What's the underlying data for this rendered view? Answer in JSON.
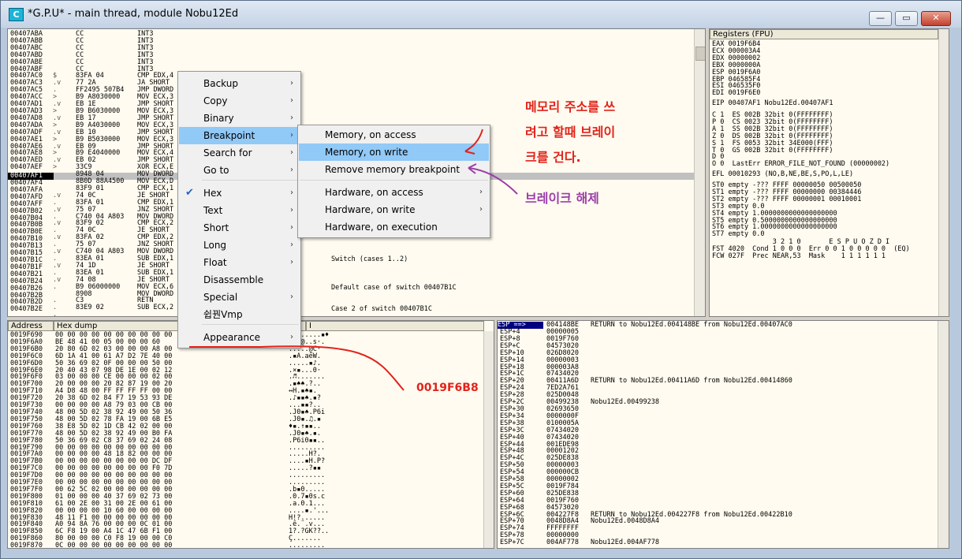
{
  "window": {
    "title": "*G.P.U* - main thread, module Nobu12Ed",
    "icon_letter": "C",
    "controls": {
      "minimize": "—",
      "maximize": "▭",
      "close": "✕"
    }
  },
  "cpu_pane": {
    "addresses": "00407ABA\n00407ABB\n00407ABC\n00407ABD\n00407ABE\n00407ABF\n00407AC0\n00407AC3\n00407AC5\n00407ACC\n00407AD1\n00407AD3\n00407AD8\n00407ADA\n00407ADF\n00407AE1\n00407AE6\n00407AE8\n00407AED\n00407AEF",
    "selected_address": "00407AF1",
    "addresses_after": "00407AF4\n00407AFA\n00407AFD\n00407AFF\n00407B02\n00407B04\n00407B0B\n00407B0E\n00407B10\n00407B13\n00407B15\n00407B1C\n00407B1F\n00407B21\n00407B24\n00407B26\n00407B2B\n00407B2D\n00407B2E",
    "markers": "\n\n\n\n\n\n$\n.v\n.\n>\n.v\n>\n.v\n>\n.v\n>\n.v\n>\n.v\n>\n\n\n\n.v\n.\n.v\n.\n.v\n.\n.v\n.\n.v\n.\n.v\n.\n.v\n.\n\n.\n.\n.",
    "hex": "CC\nCC\nCC\nCC\nCC\nCC\n83FA 04\n77 2A\nFF2495 507B4\nB9 A8030000\nEB 1E\nB9 B6030000\nEB 17\nB9 A4030000\nEB 10\nB9 B5030000\nEB 09\nB9 E4040000\nEB 02\n33C9\n8948 04\n8B0D 88A4500\n83F9 01\n74 0C\n83FA 01\n75 07\nC740 04 A803\n83F9 02\n74 0C\n83FA 02\n75 07\nC740 04 A803\n83EA 01\n74 1D\n83EA 01\n74 08\nB9 06000000\n8908\nC3\n83E9 02",
    "disasm": "INT3\nINT3\nINT3\nINT3\nINT3\nINT3\nCMP EDX,4\nJA SHORT\nJMP DWORD\nMOV ECX,3\nJMP SHORT\nMOV ECX,3\nJMP SHORT\nMOV ECX,3\nJMP SHORT\nMOV ECX,3\nJMP SHORT\nMOV ECX,4\nJMP SHORT\nXOR ECX,E\nMOV DWORD\nMOV ECX,D\nCMP ECX,1\nJE SHORT\nCMP EDX,1\nJNZ SHORT\nMOV DWORD\nCMP ECX,2\nJE SHORT\nCMP EDX,2\nJNZ SHORT\nMOV DWORD\nSUB EDX,1\nJE SHORT\nSUB EDX,1\nJE SHORT\nMOV ECX,6\nMOV DWORD\nRETN\nSUB ECX,2",
    "comment_switch": "Switch (cases 1..2)",
    "comment_default": "Default case of switch 00407B1C",
    "comment_case2": "Case 2 of switch 00407B1C"
  },
  "registers": {
    "header": "Registers (FPU)",
    "gpr": "EAX 0019F6B4\nECX 000003A4\nEDX 00000002\nEBX 0000000A\nESP 0019F6A0\nEBP 046585F4\nESI 046535F0\nEDI 0019F6E0",
    "eip": "EIP 00407AF1 Nobu12Ed.00407AF1",
    "segs": "C 1  ES 002B 32bit 0(FFFFFFFF)\nP 0  CS 0023 32bit 0(FFFFFFFF)\nA 1  SS 002B 32bit 0(FFFFFFFF)\nZ 0  DS 002B 32bit 0(FFFFFFFF)\nS 1  FS 0053 32bit 34E000(FFF)\nT 0  GS 002B 32bit 0(FFFFFFFF)\nD 0\nO 0  LastErr ERROR_FILE_NOT_FOUND (00000002)",
    "efl": "EFL 00010293 (NO,B,NE,BE,S,PO,L,LE)",
    "fpu": "ST0 empty -??? FFFF 00000050 00500050\nST1 empty -??? FFFF 00000000 00384446\nST2 empty -??? FFFF 00000001 00010001\nST3 empty 0.0\nST4 empty 1.0000000000000000000\nST5 empty 0.5000000000000000000\nST6 empty 1.0000000000000000000\nST7 empty 0.0",
    "fst": "               3 2 1 0       E S P U O Z D I\nFST 4020  Cond 1 0 0 0  Err 0 0 1 0 0 0 0 0  (EQ)\nFCW 027F  Prec NEAR,53  Mask    1 1 1 1 1 1"
  },
  "dump": {
    "col_address": "Address",
    "col_hex": "Hex dump",
    "col_ascii": "I",
    "addresses": "0019F690\n0019F6A0\n0019F6B0\n0019F6C0\n0019F6D0\n0019F6E0\n0019F6F0\n0019F700\n0019F710\n0019F720\n0019F730\n0019F740\n0019F750\n0019F760\n0019F770\n0019F780\n0019F790\n0019F7A0\n0019F7B0\n0019F7C0\n0019F7D0\n0019F7E0\n0019F7F0\n0019F800\n0019F810\n0019F820\n0019F830\n0019F840\n0019F850\n0019F860\n0019F870",
    "hex": "00 00 00 00 00 00 00 00 00 00\nBE 48 41 00 05 00 00 00 60\n20 80 6D 02 03 00 00 00 A8 00\n6D 1A 41 00 61 A7 D2 7E 40 00\n50 36 69 02 0F 00 00 00 50 00\n20 40 43 07 98 DE 1E 00 02 12\n03 00 00 00 CE 00 00 00 02 00\n20 00 00 00 20 82 87 19 00 20\nA4 D8 48 00 FF FF FF FF 00 00\n20 38 6D 02 84 F7 19 53 93 DE\n00 00 00 00 A8 79 03 00 CB 00\n48 00 5D 02 38 92 49 00 50 36\n48 00 5D 02 78 FA 19 00 6B E5\n38 E8 5D 02 1D CB 42 02 00 00\n48 00 5D 02 38 92 49 00 B0 FA\n50 36 69 02 C8 37 69 02 24 08\n00 00 00 00 00 00 00 00 00 00\n00 00 00 00 48 18 82 00 00 00\n00 00 00 00 00 00 00 00 DC DF\n00 00 00 00 00 00 00 00 F0 7D\n00 00 00 00 00 00 00 00 00 00\n00 00 00 00 00 00 00 00 00 00\n00 62 5C 02 00 00 00 00 00 00\n01 00 00 00 40 37 69 02 73 00\n61 00 2E 00 31 00 2E 00 61 00\n00 00 00 00 10 60 00 00 00 00\n48 11 F1 00 00 00 00 00 00 00\nA0 94 8A 76 00 00 00 0C 01 00\n6C F8 19 00 A4 1C 47 6B F1 00\n80 00 00 00 C0 F8 19 00 00 C0\n0C 00 00 00 00 00 00 00 00 00",
    "ascii": "  ......▪♦\n!..@..s·.\n.....@C·\n.▪A.aëW.\n.....▪♪.\n.×▪...0·\n.♬.......\n.▪♠♠.?..\n↔H.▪♠▪.\n.♪▪▪♠.▪?\n...▪▪?..\n.J0▪♠.P6i\n.J0▪.♫.▪\n♦▪.↑▪▪..\n.J0▪♠.▪.\n.P6i0▪▪..\n.........\n.....H?.\n....▪H.P?\n.....?▪▪\n.........\n.........\n.b▪0.....\n.0.7▪0s.c\n.a.0.1...\n....▪.'...\nH!?......\n.ê.¨.v...\n1?.?GK??..\nÇ.......\n........."
  },
  "stack": {
    "top": "ESP ==>",
    "offsets": "ESP+4\nESP+8\nESP+C\nESP+10\nESP+14\nESP+18\nESP+1C\nESP+20\nESP+24\nESP+28\nESP+2C\nESP+30\nESP+34\nESP+38\nESP+3C\nESP+40\nESP+44\nESP+48\nESP+4C\nESP+50\nESP+54\nESP+58\nESP+5C\nESP+60\nESP+64\nESP+68\nESP+6C\nESP+70\nESP+74\nESP+78\nESP+7C",
    "top_value": "004148BE",
    "values": "00000005\n0019F760\n04573020\n026D8020\n00000003\n000003A8\n07434020\n00411A6D\n7ED2A761\n025D0048\n00499238\n02693650\n0000000F\n0100005A\n07434020\n07434020\n001EDE98\n00001202\n025DE838\n00000003\n000000CB\n00000002\n0019F784\n025DE838\n0019F760\n04573020\n004227F8\n0048D8A4\nFFFFFFFF\n00000000\n004AF778",
    "top_comment": "RETURN to Nobu12Ed.004148BE from Nobu12Ed.00407AC0",
    "comments": "\n\n\n\n\n\n\nRETURN to Nobu12Ed.00411A6D from Nobu12Ed.00414860\n\n\nNobu12Ed.00499238\n\n\n\n\n\n\n\n\n\n\n\n\n\n\n\nRETURN to Nobu12Ed.004227F8 from Nobu12Ed.00422B10\nNobu12Ed.0048D8A4\n\n\nNobu12Ed.004AF778"
  },
  "context_menu": {
    "items": [
      {
        "label": "Backup",
        "submenu": true
      },
      {
        "label": "Copy",
        "submenu": true
      },
      {
        "label": "Binary",
        "submenu": true
      },
      {
        "label": "Breakpoint",
        "submenu": true
      },
      {
        "label": "Search for",
        "submenu": true
      },
      {
        "label": "Go to",
        "submenu": true
      },
      {
        "label": "Hex",
        "submenu": true,
        "checked": true
      },
      {
        "label": "Text",
        "submenu": true
      },
      {
        "label": "Short",
        "submenu": true
      },
      {
        "label": "Long",
        "submenu": true
      },
      {
        "label": "Float",
        "submenu": true
      },
      {
        "label": "Disassemble",
        "submenu": false
      },
      {
        "label": "Special",
        "submenu": true
      },
      {
        "label": "쉽꿘Vmp",
        "submenu": false
      },
      {
        "label": "Appearance",
        "submenu": true
      }
    ],
    "submenu_arrow": "›",
    "check_mark": "✔"
  },
  "breakpoint_submenu": {
    "items": [
      {
        "label": "Memory, on access"
      },
      {
        "label": "Memory, on write"
      },
      {
        "label": "Remove memory breakpoint"
      },
      {
        "label": "Hardware, on access"
      },
      {
        "label": "Hardware, on write"
      },
      {
        "label": "Hardware, on execution"
      }
    ]
  },
  "annotations": {
    "red_line1": "메모리 주소를 쓰",
    "red_line2": "려고 할때 브레이",
    "red_line3": "크를 건다.",
    "purple": "브레이크 해제",
    "address_label": "0019F6B8",
    "red_color": "#e2231a",
    "purple_color": "#9b3fa8"
  }
}
